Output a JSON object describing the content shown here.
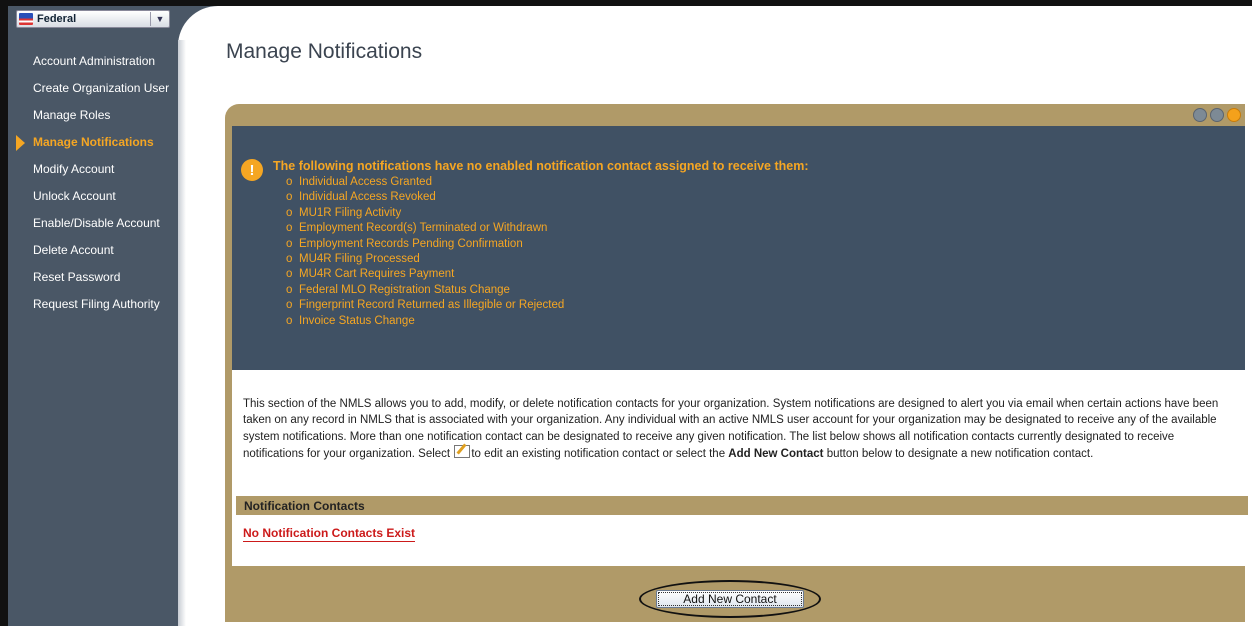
{
  "sidebar": {
    "org_select": "Federal",
    "items": [
      {
        "label": "Account Administration",
        "active": false
      },
      {
        "label": "Create Organization User",
        "active": false
      },
      {
        "label": "Manage Roles",
        "active": false
      },
      {
        "label": "Manage Notifications",
        "active": true
      },
      {
        "label": "Modify Account",
        "active": false
      },
      {
        "label": "Unlock Account",
        "active": false
      },
      {
        "label": "Enable/Disable Account",
        "active": false
      },
      {
        "label": "Delete Account",
        "active": false
      },
      {
        "label": "Reset Password",
        "active": false
      },
      {
        "label": "Request Filing Authority",
        "active": false
      }
    ]
  },
  "page": {
    "title": "Manage Notifications"
  },
  "alert": {
    "title": "The following notifications have no enabled notification contact assigned to receive them:",
    "bullet": "o",
    "items": [
      "Individual Access Granted",
      "Individual Access Revoked",
      "MU1R Filing Activity",
      "Employment Record(s) Terminated or Withdrawn",
      "Employment Records Pending Confirmation",
      "MU4R Filing Processed",
      "MU4R Cart Requires Payment",
      "Federal MLO Registration Status Change",
      "Fingerprint Record Returned as Illegible or Rejected",
      "Invoice Status Change"
    ]
  },
  "description": {
    "part1": "This section of the NMLS allows you to add, modify, or delete notification contacts for your organization. System notifications are designed to alert you via email when certain actions have been taken on any record in NMLS that is associated with your organization. Any individual with an active NMLS user account for your organization may be designated to receive any of the available system notifications. More than one notification contact can be designated to receive any given notification. The list below shows all notification contacts currently designated to receive notifications for your organization. Select ",
    "part2": "to edit an existing notification contact or select the ",
    "bold": "Add New Contact",
    "part3": " button below to designate a new notification contact."
  },
  "contacts": {
    "header": "Notification Contacts",
    "empty_message": "No Notification Contacts Exist"
  },
  "actions": {
    "add_label": "Add New Contact"
  },
  "colors": {
    "sidebar_bg": "#4a5766",
    "accent": "#f5a623",
    "panel_tan": "#b09a68",
    "alert_bg": "#405164",
    "error_red": "#cc1a1a"
  }
}
